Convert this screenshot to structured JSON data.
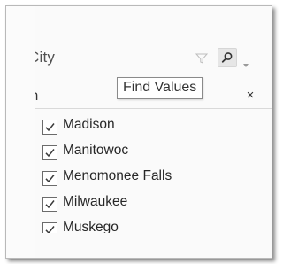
{
  "filter_card": {
    "title": "City",
    "filter_icon": "funnel-icon",
    "search_icon": "magnifier-icon",
    "menu_icon": "chevron-down-icon",
    "tooltip": "Find Values",
    "search": {
      "value": "m",
      "clear_label": "×"
    },
    "items": [
      {
        "label": "Madison",
        "checked": true
      },
      {
        "label": "Manitowoc",
        "checked": true
      },
      {
        "label": "Menomonee Falls",
        "checked": true
      },
      {
        "label": "Milwaukee",
        "checked": true
      },
      {
        "label": "Muskego",
        "checked": true
      }
    ]
  }
}
